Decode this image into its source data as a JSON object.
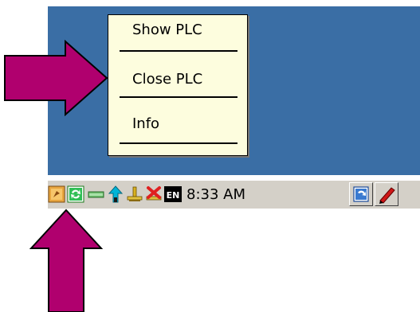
{
  "context_menu": {
    "items": [
      {
        "label": "Show PLC"
      },
      {
        "label": "Close PLC"
      },
      {
        "label": "Info"
      }
    ]
  },
  "taskbar": {
    "tray_icons": [
      {
        "icon": "plc-runtime-icon",
        "color": "#d9922b"
      },
      {
        "icon": "sync-icon",
        "color": "#1fae4b"
      },
      {
        "icon": "battery-icon",
        "color": "#3c8a3c"
      },
      {
        "icon": "network-up-arrow-icon",
        "color": "#00a0c8"
      },
      {
        "icon": "usb-connection-icon",
        "color": "#c8a000"
      },
      {
        "icon": "usb-disconnected-icon",
        "color": "#d02020"
      }
    ],
    "input_language": "EN",
    "clock": "8:33 AM",
    "quick_buttons": [
      {
        "icon": "desktop-switch-icon"
      },
      {
        "icon": "pen-icon"
      }
    ]
  },
  "annotations": {
    "arrow_color": "#b0006e"
  },
  "colors": {
    "desktop": "#3a6ea5",
    "menu_background": "#fdfdde",
    "taskbar": "#d4d0c8"
  }
}
